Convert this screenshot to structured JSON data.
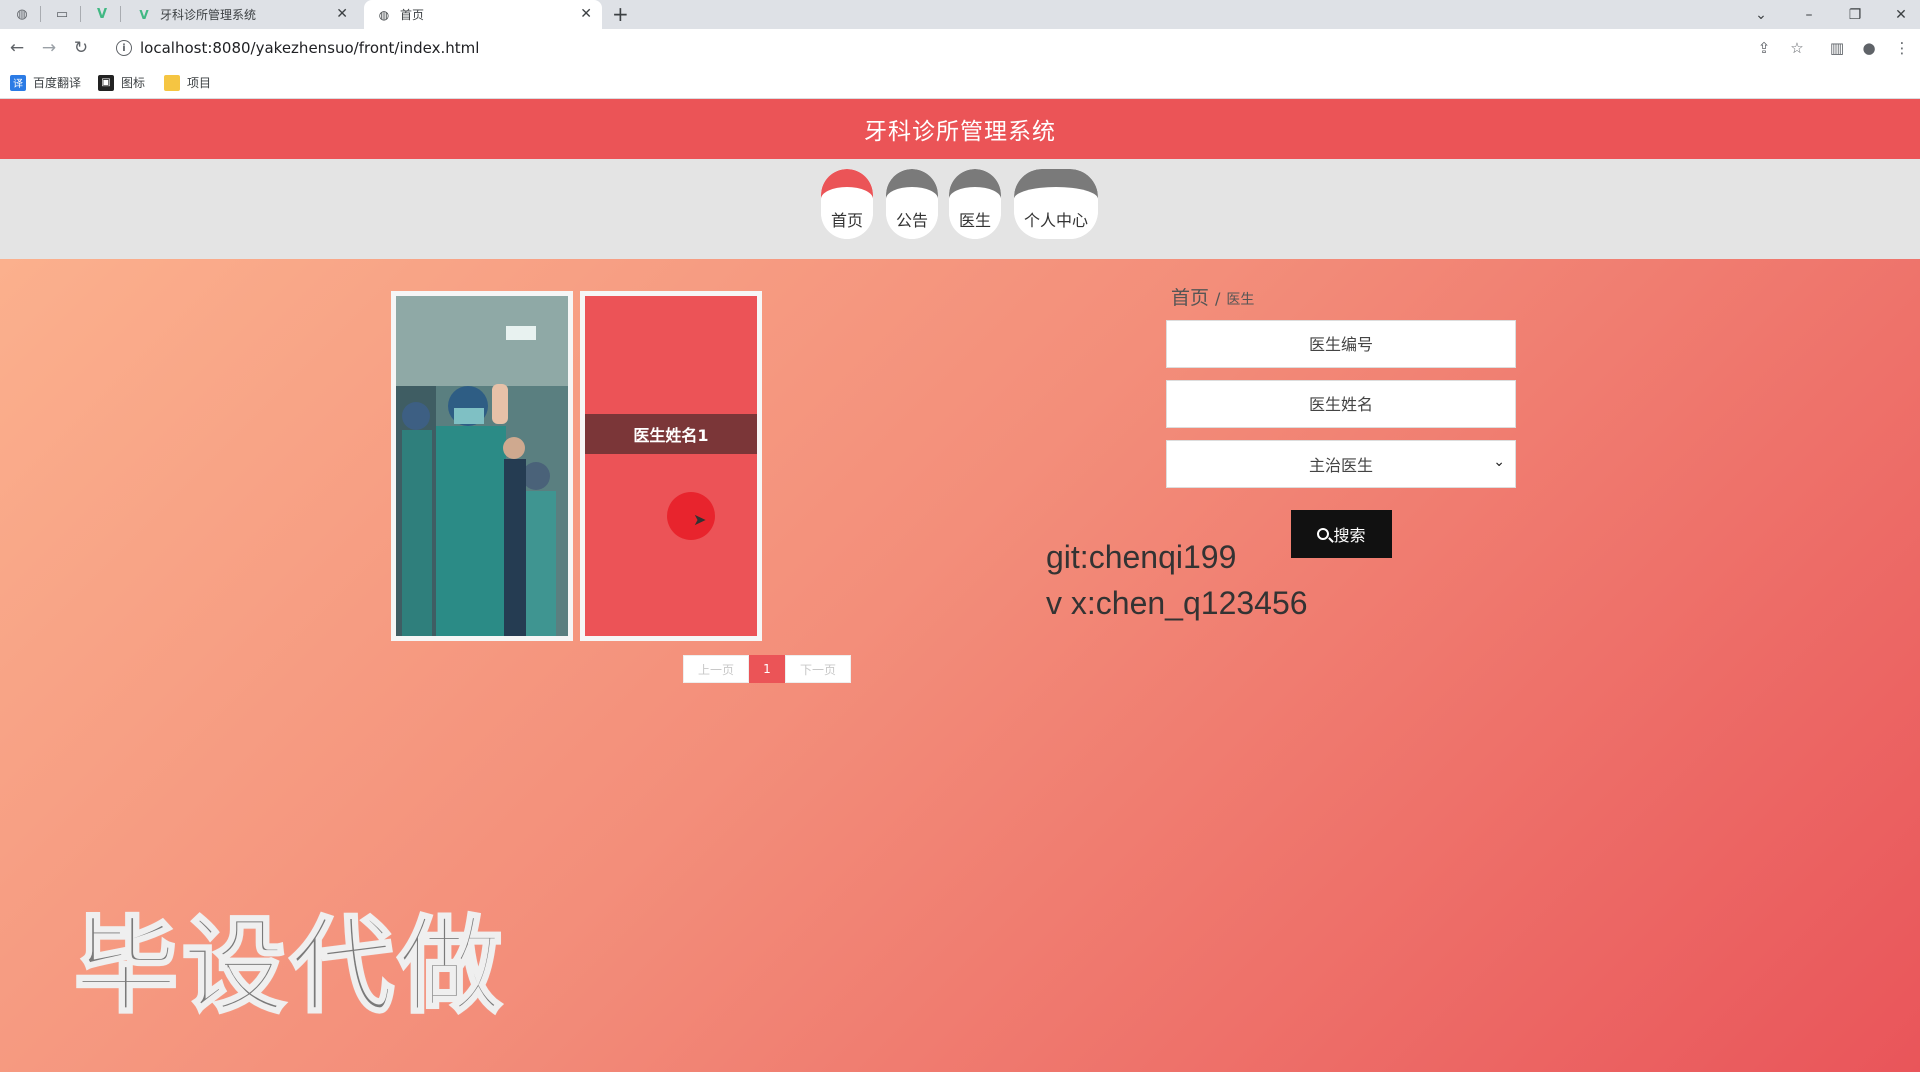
{
  "browser": {
    "tabs": [
      {
        "title": "牙科诊所管理系统",
        "active": false
      },
      {
        "title": "首页",
        "active": true
      }
    ],
    "url": "localhost:8080/yakezhensuo/front/index.html",
    "bookmarks": [
      {
        "label": "百度翻译",
        "icon": "translate-icon"
      },
      {
        "label": "图标",
        "icon": "image-icon"
      },
      {
        "label": "项目",
        "icon": "folder-icon"
      }
    ]
  },
  "header": {
    "title": "牙科诊所管理系统"
  },
  "nav": {
    "items": [
      {
        "label": "首页",
        "active": true
      },
      {
        "label": "公告",
        "active": false
      },
      {
        "label": "医生",
        "active": false
      },
      {
        "label": "个人中心",
        "active": false
      }
    ]
  },
  "cards": [
    {
      "name": "医生姓名1"
    }
  ],
  "pager": {
    "prev": "上一页",
    "current": "1",
    "next": "下一页"
  },
  "breadcrumb": {
    "home": "首页",
    "separator": "/",
    "current": "医生"
  },
  "search": {
    "field1_placeholder": "医生编号",
    "field2_placeholder": "医生姓名",
    "select_value": "主治医生",
    "button_label": "搜索"
  },
  "contact": {
    "line1": "git:chenqi199",
    "line2": "v x:chen_q123456"
  },
  "watermark": "毕设代做",
  "colors": {
    "accent": "#eb5457",
    "dark": "#111111"
  }
}
